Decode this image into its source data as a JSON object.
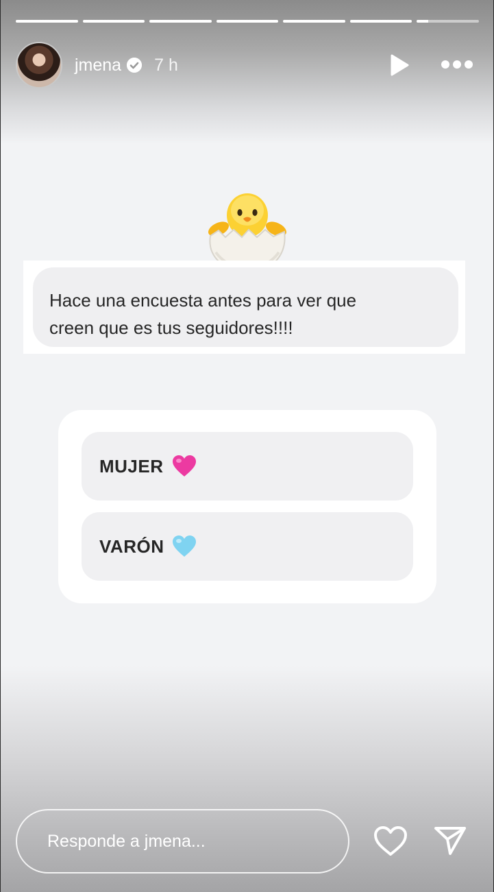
{
  "story": {
    "progress": [
      1,
      1,
      1,
      1,
      1,
      1,
      0.18
    ]
  },
  "header": {
    "username": "jmena",
    "time": "7 h",
    "icons": {
      "avatar": "profile-avatar",
      "verified": "verified-badge-icon",
      "play": "play-icon",
      "more": "more-icon"
    }
  },
  "question": {
    "emoji": "hatching-chick",
    "text_line1": "Hace una encuesta antes para ver que",
    "text_line2": "creen que es tus seguidores!!!!"
  },
  "poll": {
    "options": [
      {
        "label": "MUJER",
        "emoji": "pink-heart",
        "color": "#e8359a"
      },
      {
        "label": "VARÓN",
        "emoji": "light-blue-heart",
        "color": "#7fd3f1"
      }
    ]
  },
  "footer": {
    "reply_placeholder": "Responde a jmena...",
    "icons": {
      "like": "heart-outline-icon",
      "send": "send-icon"
    }
  }
}
